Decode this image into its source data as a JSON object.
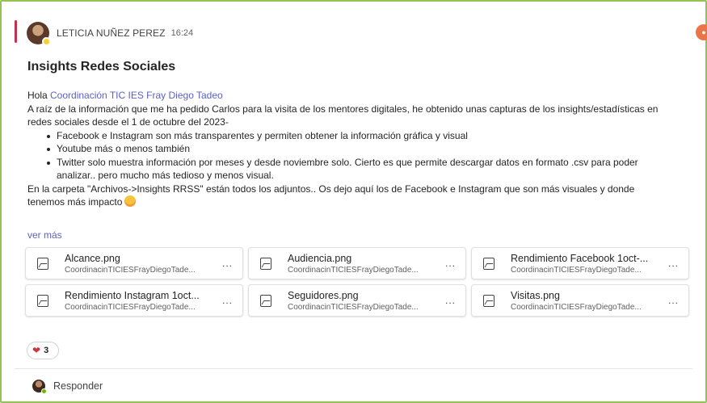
{
  "post": {
    "author": "LETICIA NUÑEZ PEREZ",
    "time": "16:24",
    "subject": "Insights Redes Sociales",
    "greeting": "Hola ",
    "mention": "Coordinación TIC IES Fray Diego Tadeo",
    "paragraph1": "A raíz de la información que me ha pedido Carlos para la visita de los mentores digitales, he obtenido unas capturas de los insights/estadísticas en redes sociales desde el 1 de octubre del 2023-",
    "bullets": [
      "Facebook e Instagram son más transparentes y permiten obtener la información gráfica y visual",
      "Youtube más o menos también",
      "Twitter solo muestra información por meses y desde noviembre solo. Cierto es que permite descargar datos en formato .csv para poder analizar.. pero mucho más tedioso y menos visual."
    ],
    "paragraph2": "En la carpeta \"Archivos->Insights RRSS\" están todos los adjuntos.. Os dejo aquí los de Facebook e Instagram que son más visuales y donde tenemos más impacto",
    "see_more": "ver más"
  },
  "attachments": [
    {
      "name": "Alcance.png",
      "path": "CoordinacinTICIESFrayDiegoTade...",
      "more": "..."
    },
    {
      "name": "Audiencia.png",
      "path": "CoordinacinTICIESFrayDiegoTade...",
      "more": "..."
    },
    {
      "name": "Rendimiento Facebook 1oct-...",
      "path": "CoordinacinTICIESFrayDiegoTade...",
      "more": "..."
    },
    {
      "name": "Rendimiento Instagram 1oct...",
      "path": "CoordinacinTICIESFrayDiegoTade...",
      "more": "..."
    },
    {
      "name": "Seguidores.png",
      "path": "CoordinacinTICIESFrayDiegoTade...",
      "more": "..."
    },
    {
      "name": "Visitas.png",
      "path": "CoordinacinTICIESFrayDiegoTade...",
      "more": "..."
    }
  ],
  "reaction": {
    "icon": "heart-icon",
    "count": "3"
  },
  "reply": {
    "label": "Responder"
  },
  "colors": {
    "accent": "#c4314b",
    "link": "#5b5fc7",
    "frame": "#92c353"
  }
}
